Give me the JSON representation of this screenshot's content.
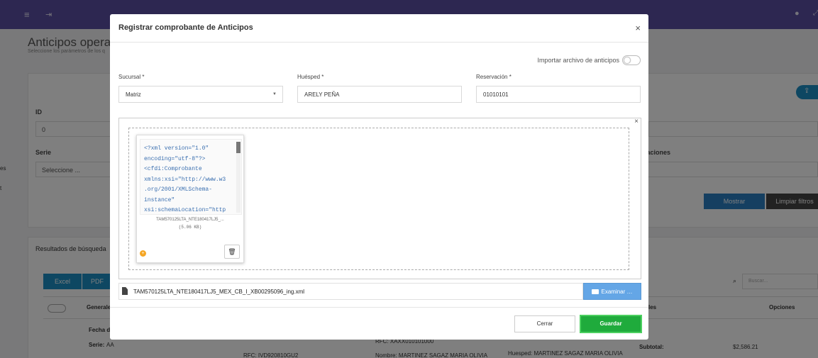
{
  "background": {
    "page_title": "Anticipos opera p",
    "page_subtitle": "Seleccione los parámetros de los q",
    "id_label": "ID",
    "id_value": "0",
    "serie_label": "Serie",
    "serie_value": "Seleccione ...",
    "observaciones_label": "rvaciones",
    "mostrar_button": "Mostrar",
    "limpiar_button": "Limpiar filtros",
    "results_title": "Resultados de búsqueda",
    "excel_button": "Excel",
    "pdf_button": "PDF",
    "search_placeholder": "Buscar...",
    "col_general": "Generale",
    "col_totales": "les",
    "col_opciones": "Opciones",
    "row_fecha": "Fecha d",
    "row_serie_label": "Serie:",
    "row_serie_value": "AA",
    "rfc1": "RFC: XAXX010101000",
    "rfc2": "RFC: IVD920810GU2",
    "nombre": "Nombre: MARTINEZ SAGAZ MARIA OLIVIA",
    "huesped": "Huesped: MARTINEZ SAGAZ MARIA OLIVIA",
    "subtotal_label": "Subtotal:",
    "subtotal_value": "$2,586.21",
    "left_edge_1": "es",
    "left_edge_2": "t"
  },
  "modal": {
    "title": "Registrar comprobante de Anticipos",
    "close": "×",
    "import_toggle_label": "Importar archivo de anticipos",
    "sucursal_label": "Sucursal *",
    "sucursal_value": "Matriz",
    "huesped_label": "Huésped *",
    "huesped_value": "ARELY PEÑA",
    "reservacion_label": "Reservación *",
    "reservacion_value": "01010101",
    "upload_close": "×",
    "preview_code": "<?xml version=\"1.0\"\nencoding=\"utf-8\"?>\n<cfdi:Comprobante\nxmlns:xsi=\"http://www.w3\n.org/2001/XMLSchema-\ninstance\"\nxsi:schemaLocation=\"http",
    "preview_filename": "TAM570125LTA_NTE180417LJ5_...",
    "preview_size": "(5.06 KB)",
    "selected_file": "TAM570125LTA_NTE180417LJ5_MEX_CB_I_XB00295096_ing.xml",
    "browse_button": "Examinar …",
    "cancel_button": "Cerrar",
    "save_button": "Guardar"
  },
  "colors": {
    "topbar": "#5b4ea3",
    "browse": "#64a6e6",
    "save": "#1fab3c",
    "save_border": "#4cd060",
    "mostrar": "#2a7fc3",
    "limpiar": "#454545",
    "excel": "#1c8fc5"
  },
  "icons": [
    "menu-icon",
    "logout-icon",
    "bell-icon",
    "expand-icon",
    "upload-icon",
    "search-icon",
    "file-icon",
    "folder-icon",
    "trash-icon",
    "status-dot-icon",
    "chevron-down-icon",
    "close-icon"
  ]
}
